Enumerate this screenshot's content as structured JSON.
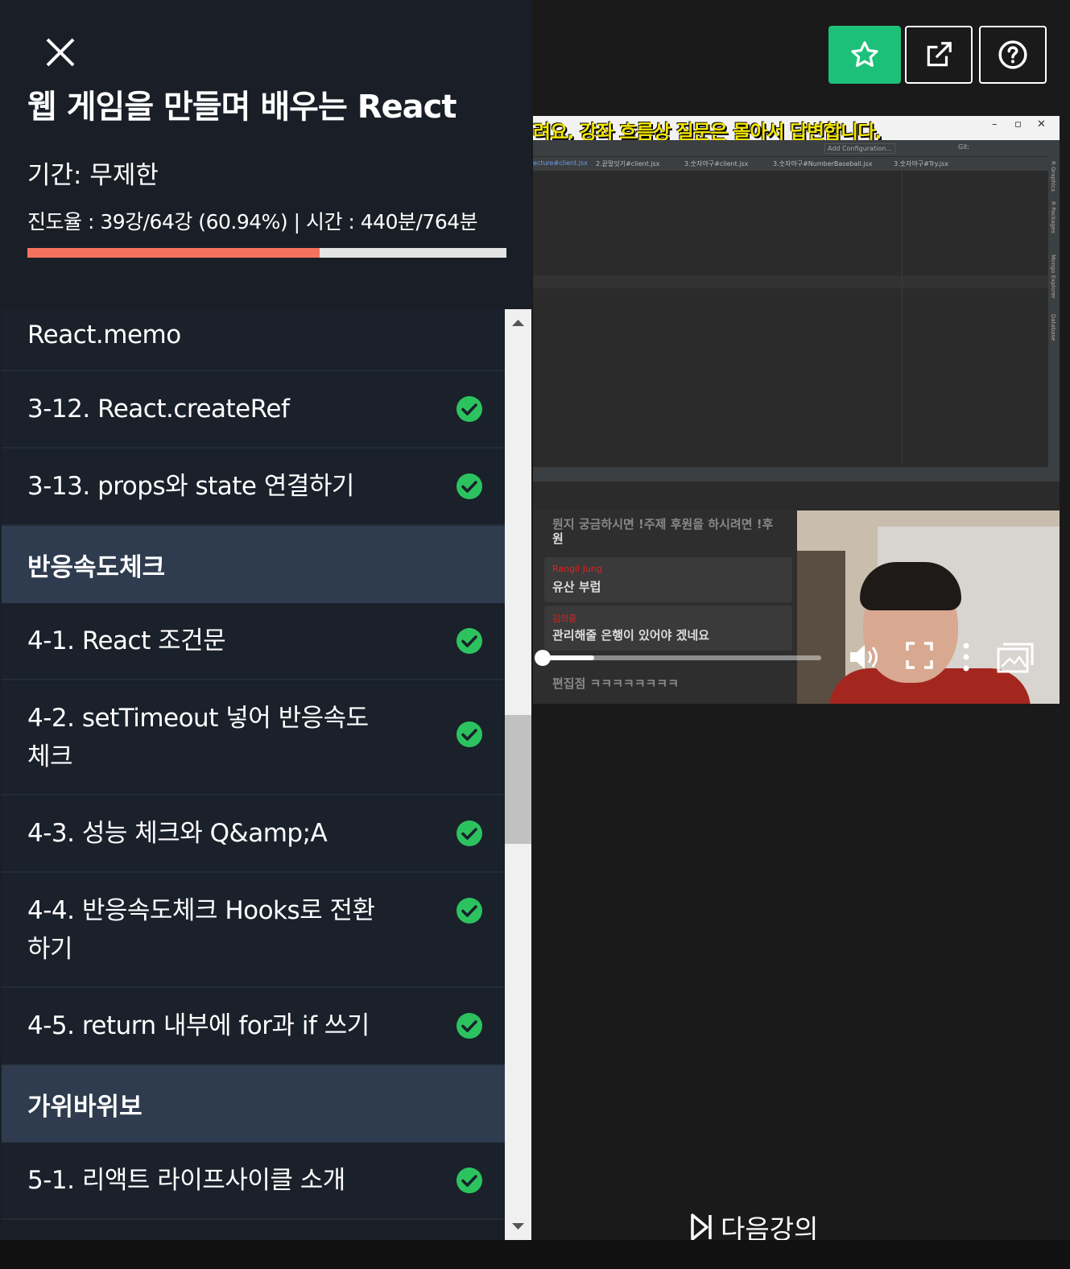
{
  "course": {
    "title": "웹 게임을 만들며 배우는 React",
    "period": "기간: 무제한",
    "progress_text": "진도율 : 39강/64강 (60.94%) | 시간 : 440분/764분",
    "progress_ratio": 0.6094
  },
  "lectures": [
    {
      "label": "React.memo",
      "completed": false
    },
    {
      "label": "3-12. React.createRef",
      "completed": true
    },
    {
      "label": "3-13. props와 state 연결하기",
      "completed": true
    }
  ],
  "section_reaction": {
    "title": "반응속도체크",
    "lectures": [
      {
        "label": "4-1. React 조건문",
        "completed": true
      },
      {
        "label": "4-2. setTimeout 넣어 반응속도 체크",
        "completed": true
      },
      {
        "label": "4-3. 성능 체크와 Q&amp;A",
        "completed": true
      },
      {
        "label": "4-4. 반응속도체크 Hooks로 전환하기",
        "completed": true
      },
      {
        "label": "4-5. return 내부에 for과 if 쓰기",
        "completed": true
      }
    ]
  },
  "section_rps": {
    "title": "가위바위보",
    "lectures": [
      {
        "label": "5-1. 리액트 라이프사이클 소개",
        "completed": true
      }
    ]
  },
  "video": {
    "banner": "려요. 강좌 흐름상 질문은 몰아서 답변합니다.",
    "ide_add_config": "Add Configuration...",
    "ide_git": "Git:",
    "ide_tabs": [
      "ecture#client.jsx",
      "2.끝말잇기#client.jsx",
      "3.숫자야구#client.jsx",
      "3.숫자야구#NumberBaseball.jsx",
      "3.숫자야구#Try.jsx"
    ],
    "ide_side": [
      "R Graphics",
      "R Packages",
      "Mongo Explorer",
      "Database"
    ],
    "chat": [
      {
        "user": "",
        "message": "뭔지 궁금하시면 !주제 후원을 하시려면 !후"
      },
      {
        "user": "",
        "message": "원"
      },
      {
        "user": "Rangil Jung",
        "message": "유산 부럽"
      },
      {
        "user": "김의중",
        "message": "관리해줄 은행이 있어야 겠네요"
      },
      {
        "user": "",
        "message": "편집점 ㅋㅋㅋㅋㅋㅋㅋㅋ"
      }
    ],
    "seek_ratio": 0.2
  },
  "player": {
    "next_label": "다음강의"
  },
  "colors": {
    "accent_green": "#1dc078",
    "progress_red": "#f4735f",
    "check_green": "#2cc35f",
    "section_bg": "#2f3c4f"
  },
  "icons": [
    "close-icon",
    "star-icon",
    "share-icon",
    "help-icon",
    "check-circle-icon",
    "volume-icon",
    "fullscreen-icon",
    "more-icon",
    "picture-in-picture-icon",
    "next-lecture-icon"
  ]
}
